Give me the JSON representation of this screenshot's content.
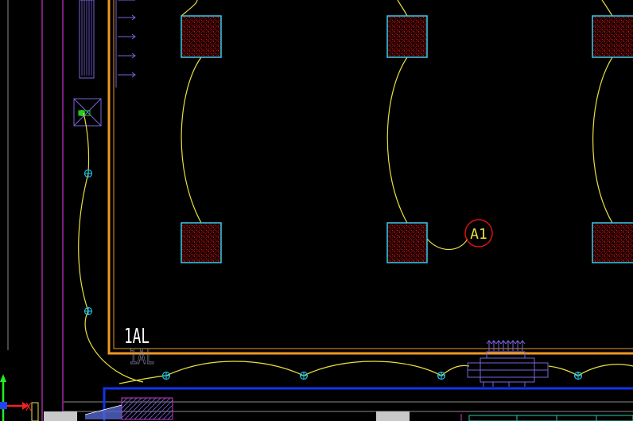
{
  "drawing": {
    "callout_label": "A1",
    "panel_label_primary": "1AL",
    "panel_label_shadow": "1AL",
    "ucs_axis_label": "X",
    "colors": {
      "background": "#000000",
      "column_outline": "#33ccee",
      "column_hatch": "#cc1111",
      "circuit_wire": "#e8e040",
      "outer_wall": "#ee9922",
      "trunking": "#1133ee",
      "callout_ring": "#dd1111",
      "junction_box": "#22bbdd",
      "magenta_line": "#cc33cc",
      "violet_line": "#7766dd"
    }
  }
}
